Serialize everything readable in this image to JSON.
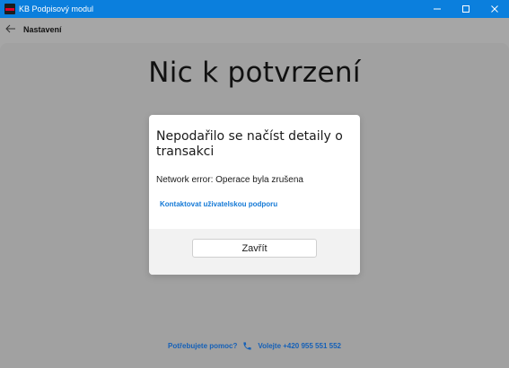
{
  "window": {
    "title": "KB Podpisový modul",
    "controls": {
      "minimize": "—",
      "maximize": "☐",
      "close": "✕"
    }
  },
  "nav": {
    "back_icon": "back-arrow-icon",
    "title": "Nastavení"
  },
  "main": {
    "heading": "Nic k potvrzení"
  },
  "dialog": {
    "title": "Nepodařilo se načíst detaily o transakci",
    "message": "Network error: Operace byla zrušena",
    "link": "Kontaktovat uživatelskou podporu",
    "close_label": "Zavřít"
  },
  "help": {
    "question": "Potřebujete pomoc?",
    "call": "Volejte +420 955 551 552",
    "icon": "phone-icon"
  },
  "colors": {
    "titlebar": "#0b7fdd",
    "overlay": "#a6a6a6",
    "link": "#1479d6",
    "help": "#1460b8",
    "brand_red": "#e4002b"
  }
}
